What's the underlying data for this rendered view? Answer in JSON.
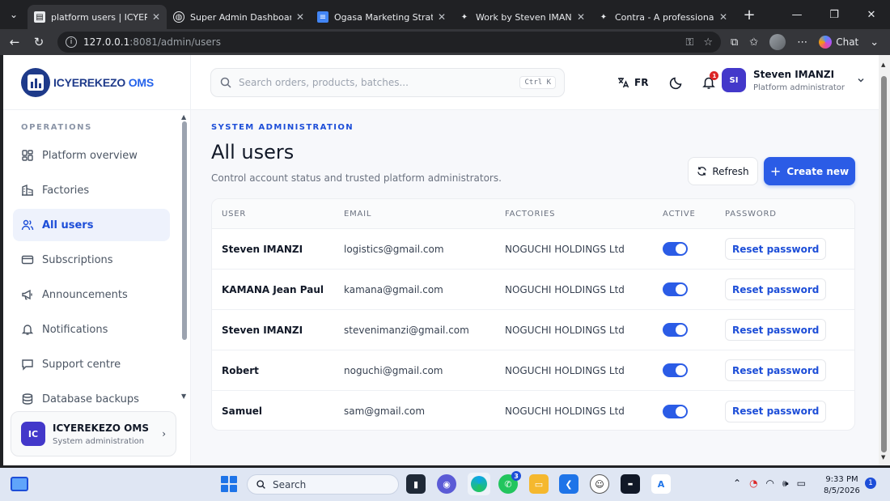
{
  "browser": {
    "tabs": [
      {
        "title": "platform users | ICYEREKEZO",
        "active": true,
        "favicon": "page-icon"
      },
      {
        "title": "Super Admin Dashboard - L",
        "active": false,
        "favicon": "globe-icon"
      },
      {
        "title": "Ogasa Marketing Strategy P",
        "active": false,
        "favicon": "docs-icon"
      },
      {
        "title": "Work by Steven IMANZI",
        "active": false,
        "favicon": "contra-icon"
      },
      {
        "title": "Contra - A professional netw",
        "active": false,
        "favicon": "contra-icon"
      }
    ],
    "url_host": "127.0.0.1",
    "url_rest": ":8081/admin/users",
    "chat_label": "Chat"
  },
  "brand": {
    "name": "ICYEREKEZO",
    "suffix": "OMS"
  },
  "sidebar": {
    "section_label": "OPERATIONS",
    "items": [
      {
        "label": "Platform overview",
        "icon": "grid-icon",
        "active": false
      },
      {
        "label": "Factories",
        "icon": "building-icon",
        "active": false
      },
      {
        "label": "All users",
        "icon": "users-icon",
        "active": true
      },
      {
        "label": "Subscriptions",
        "icon": "card-icon",
        "active": false
      },
      {
        "label": "Announcements",
        "icon": "megaphone-icon",
        "active": false
      },
      {
        "label": "Notifications",
        "icon": "bell-icon",
        "active": false
      },
      {
        "label": "Support centre",
        "icon": "chat-icon",
        "active": false
      },
      {
        "label": "Database backups",
        "icon": "database-icon",
        "active": false
      }
    ],
    "org": {
      "initials": "IC",
      "name": "ICYEREKEZO OMS",
      "subtitle": "System administration"
    }
  },
  "header": {
    "search_placeholder": "Search orders, products, batches...",
    "shortcut": "Ctrl K",
    "language": "FR",
    "notification_count": "1",
    "user": {
      "initials": "SI",
      "name": "Steven IMANZI",
      "role": "Platform administrator"
    }
  },
  "main": {
    "eyebrow": "SYSTEM ADMINISTRATION",
    "title": "All users",
    "subtitle": "Control account status and trusted platform administrators.",
    "refresh_label": "Refresh",
    "create_label": "Create new",
    "columns": {
      "user": "USER",
      "email": "EMAIL",
      "factories": "FACTORIES",
      "active": "ACTIVE",
      "password": "PASSWORD"
    },
    "rows": [
      {
        "name": "Steven IMANZI",
        "email": "logistics@gmail.com",
        "factory": "NOGUCHI HOLDINGS Ltd",
        "active": true,
        "action": "Reset password"
      },
      {
        "name": "KAMANA Jean Paul",
        "email": "kamana@gmail.com",
        "factory": "NOGUCHI HOLDINGS Ltd",
        "active": true,
        "action": "Reset password"
      },
      {
        "name": "Steven IMANZI",
        "email": "stevenimanzi@gmail.com",
        "factory": "NOGUCHI HOLDINGS Ltd",
        "active": true,
        "action": "Reset password"
      },
      {
        "name": "Robert",
        "email": "noguchi@gmail.com",
        "factory": "NOGUCHI HOLDINGS Ltd",
        "active": true,
        "action": "Reset password"
      },
      {
        "name": "Samuel",
        "email": "sam@gmail.com",
        "factory": "NOGUCHI HOLDINGS Ltd",
        "active": true,
        "action": "Reset password"
      }
    ]
  },
  "taskbar": {
    "search_label": "Search",
    "whatsapp_badge": "3",
    "time": "9:33 PM",
    "date": "8/5/2026",
    "notification_count": "1"
  },
  "colors": {
    "accent": "#2b5ce6",
    "brand": "#1e3a8a",
    "sidebar_active_bg": "#eef2fc"
  }
}
